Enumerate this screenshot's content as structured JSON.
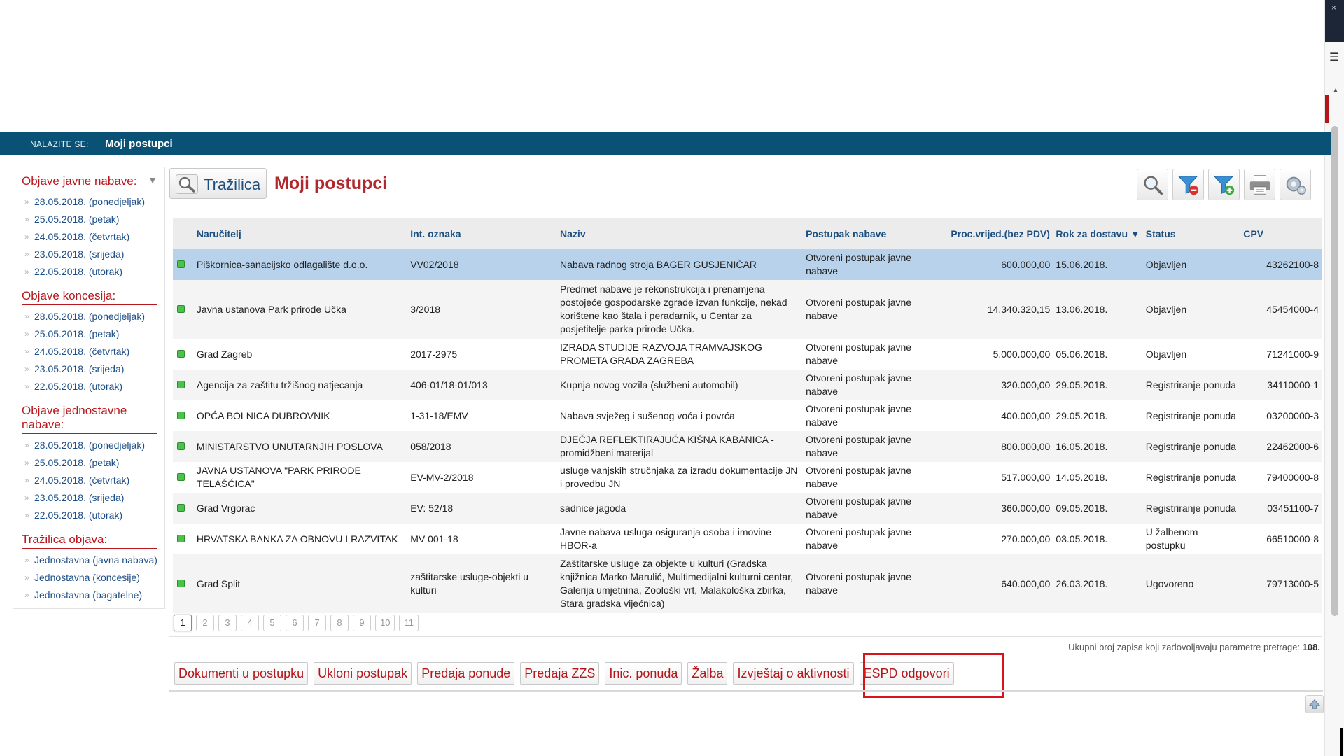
{
  "breadcrumb": {
    "label": "NALAZITE SE:",
    "current": "Moji postupci"
  },
  "sidebar": {
    "sections": [
      {
        "title": "Objave javne nabave:",
        "items": [
          "28.05.2018. (ponedjeljak)",
          "25.05.2018. (petak)",
          "24.05.2018. (četvrtak)",
          "23.05.2018. (srijeda)",
          "22.05.2018. (utorak)"
        ]
      },
      {
        "title": "Objave koncesija:",
        "items": [
          "28.05.2018. (ponedjeljak)",
          "25.05.2018. (petak)",
          "24.05.2018. (četvrtak)",
          "23.05.2018. (srijeda)",
          "22.05.2018. (utorak)"
        ]
      },
      {
        "title": "Objave jednostavne nabave:",
        "items": [
          "28.05.2018. (ponedjeljak)",
          "25.05.2018. (petak)",
          "24.05.2018. (četvrtak)",
          "23.05.2018. (srijeda)",
          "22.05.2018. (utorak)"
        ]
      },
      {
        "title": "Tražilica objava:",
        "items": [
          "Jednostavna (javna nabava)",
          "Jednostavna (koncesije)",
          "Jednostavna (bagatelne)"
        ]
      }
    ]
  },
  "main": {
    "search_button": "Tražilica",
    "title": "Moji postupci",
    "toolbar_icons": [
      "search-icon",
      "filter-remove-icon",
      "filter-add-icon",
      "print-icon",
      "settings-icon"
    ]
  },
  "table": {
    "columns": [
      "Naručitelj",
      "Int. oznaka",
      "Naziv",
      "Postupak nabave",
      "Proc.vrijed.(bez PDV)",
      "Rok za dostavu ▼",
      "Status",
      "CPV"
    ],
    "rows": [
      {
        "narucitelj": "Piškornica-sanacijsko odlagalište d.o.o.",
        "oznaka": "VV02/2018",
        "naziv": "Nabava radnog stroja BAGER GUSJENIČAR",
        "postupak": "Otvoreni postupak javne nabave",
        "vrijednost": "600.000,00",
        "rok": "15.06.2018.",
        "status": "Objavljen",
        "cpv": "43262100-8"
      },
      {
        "narucitelj": "Javna ustanova Park prirode Učka",
        "oznaka": "3/2018",
        "naziv": "Predmet nabave je rekonstrukcija i prenamjena postojeće gospodarske zgrade izvan funkcije, nekad korištene kao štala i peradarnik, u Centar za posjetitelje parka prirode Učka.",
        "postupak": "Otvoreni postupak javne nabave",
        "vrijednost": "14.340.320,15",
        "rok": "13.06.2018.",
        "status": "Objavljen",
        "cpv": "45454000-4"
      },
      {
        "narucitelj": "Grad Zagreb",
        "oznaka": "2017-2975",
        "naziv": "IZRADA STUDIJE RAZVOJA TRAMVAJSKOG PROMETA GRADA ZAGREBA",
        "postupak": "Otvoreni postupak javne nabave",
        "vrijednost": "5.000.000,00",
        "rok": "05.06.2018.",
        "status": "Objavljen",
        "cpv": "71241000-9"
      },
      {
        "narucitelj": "Agencija za zaštitu tržišnog natjecanja",
        "oznaka": "406-01/18-01/013",
        "naziv": "Kupnja novog vozila (službeni automobil)",
        "postupak": "Otvoreni postupak javne nabave",
        "vrijednost": "320.000,00",
        "rok": "29.05.2018.",
        "status": "Registriranje ponuda",
        "cpv": "34110000-1"
      },
      {
        "narucitelj": "OPĆA BOLNICA DUBROVNIK",
        "oznaka": "1-31-18/EMV",
        "naziv": "Nabava svježeg i sušenog voća i povrća",
        "postupak": "Otvoreni postupak javne nabave",
        "vrijednost": "400.000,00",
        "rok": "29.05.2018.",
        "status": "Registriranje ponuda",
        "cpv": "03200000-3"
      },
      {
        "narucitelj": "MINISTARSTVO UNUTARNJIH POSLOVA",
        "oznaka": "058/2018",
        "naziv": "DJEČJA REFLEKTIRAJUĆA KIŠNA KABANICA - promidžbeni materijal",
        "postupak": "Otvoreni postupak javne nabave",
        "vrijednost": "800.000,00",
        "rok": "16.05.2018.",
        "status": "Registriranje ponuda",
        "cpv": "22462000-6"
      },
      {
        "narucitelj": "JAVNA USTANOVA \"PARK PRIRODE TELAŠĆICA\"",
        "oznaka": "EV-MV-2/2018",
        "naziv": "usluge vanjskih stručnjaka za izradu dokumentacije JN i provedbu JN",
        "postupak": "Otvoreni postupak javne nabave",
        "vrijednost": "517.000,00",
        "rok": "14.05.2018.",
        "status": "Registriranje ponuda",
        "cpv": "79400000-8"
      },
      {
        "narucitelj": "Grad Vrgorac",
        "oznaka": "EV: 52/18",
        "naziv": "sadnice jagoda",
        "postupak": "Otvoreni postupak javne nabave",
        "vrijednost": "360.000,00",
        "rok": "09.05.2018.",
        "status": "Registriranje ponuda",
        "cpv": "03451100-7"
      },
      {
        "narucitelj": "HRVATSKA BANKA ZA OBNOVU I RAZVITAK",
        "oznaka": "MV 001-18",
        "naziv": "Javne nabava usluga osiguranja osoba i imovine HBOR-a",
        "postupak": "Otvoreni postupak javne nabave",
        "vrijednost": "270.000,00",
        "rok": "03.05.2018.",
        "status": "U žalbenom postupku",
        "cpv": "66510000-8"
      },
      {
        "narucitelj": "Grad Split",
        "oznaka": "zaštitarske usluge-objekti u kulturi",
        "naziv": "Zaštitarske usluge za objekte u kulturi (Gradska knjižnica Marko Marulić, Multimedijalni kulturni centar, Galerija umjetnina, Zoološki vrt, Malakološka zbirka, Stara gradska vijećnica)",
        "postupak": "Otvoreni postupak javne nabave",
        "vrijednost": "640.000,00",
        "rok": "26.03.2018.",
        "status": "Ugovoreno",
        "cpv": "79713000-5"
      }
    ]
  },
  "pager": {
    "pages": [
      "1",
      "2",
      "3",
      "4",
      "5",
      "6",
      "7",
      "8",
      "9",
      "10",
      "11"
    ],
    "active": "1"
  },
  "total_text": "Ukupni broj zapisa koji zadovoljavaju parametre pretrage:",
  "total_count": "108.",
  "actions": [
    "Dokumenti u postupku",
    "Ukloni postupak",
    "Predaja ponude",
    "Predaja ZZS",
    "Inic. ponuda",
    "Žalba",
    "Izvještaj o aktivnosti",
    "ESPD odgovori"
  ],
  "colors": {
    "accent_red": "#b0272c",
    "nav_blue": "#0a5275",
    "link_blue": "#1c4e87",
    "status_green": "#4cc14c",
    "selected_row": "#b8d2ec"
  }
}
